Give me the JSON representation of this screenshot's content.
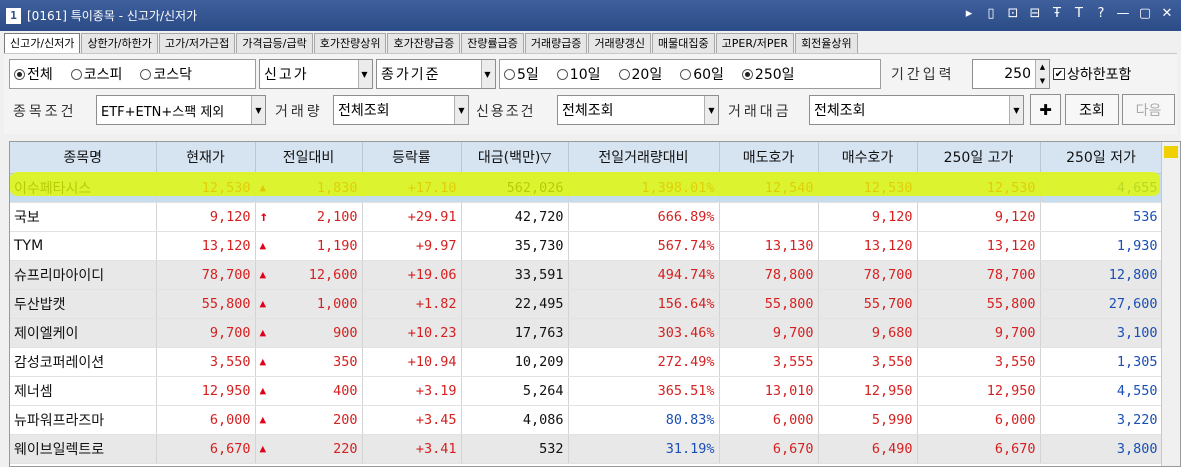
{
  "window": {
    "number": "1",
    "title": "[0161] 특이종목 - 신고가/신저가",
    "icons": [
      "▸",
      "▯",
      "⊡",
      "⊟",
      "Ŧ",
      "T",
      "?",
      "—",
      "▢",
      "✕"
    ]
  },
  "tabs": [
    {
      "label": "신고가/신저가",
      "active": true
    },
    {
      "label": "상한가/하한가"
    },
    {
      "label": "고가/저가근접"
    },
    {
      "label": "가격급등/급락"
    },
    {
      "label": "호가잔량상위"
    },
    {
      "label": "호가잔량급증"
    },
    {
      "label": "잔량률급증"
    },
    {
      "label": "거래량급증"
    },
    {
      "label": "거래량갱신"
    },
    {
      "label": "매물대집중"
    },
    {
      "label": "고PER/저PER"
    },
    {
      "label": "회전율상위"
    }
  ],
  "filters": {
    "market_radios": [
      {
        "label": "전체",
        "checked": true
      },
      {
        "label": "코스피",
        "checked": false
      },
      {
        "label": "코스닥",
        "checked": false
      }
    ],
    "type_select": "신고가",
    "basis_select": "종가기준",
    "period_radios": [
      {
        "label": "5일",
        "checked": false
      },
      {
        "label": "10일",
        "checked": false
      },
      {
        "label": "20일",
        "checked": false
      },
      {
        "label": "60일",
        "checked": false
      },
      {
        "label": "250일",
        "checked": true
      }
    ],
    "period_input_label": "기간입력",
    "period_input_value": "250",
    "limit_checkbox_label": "상하한포함",
    "limit_checkbox_checked": true,
    "stock_cond_label": "종목조건",
    "stock_cond_value": "ETF+ETN+스팩 제외",
    "volume_label": "거래량",
    "volume_value": "전체조회",
    "credit_label": "신용조건",
    "credit_value": "전체조회",
    "amount_label": "거래대금",
    "amount_value": "전체조회",
    "query_button": "조회",
    "next_button": "다음"
  },
  "table": {
    "columns": [
      "종목명",
      "현재가",
      "전일대비",
      "등락률",
      "대금(백만)▽",
      "전일거래량대비",
      "매도호가",
      "매수호가",
      "250일 고가",
      "250일 저가"
    ],
    "rows": [
      {
        "name": "이수페타시스",
        "price": "12,530",
        "sym": "▲",
        "chg": "1,830",
        "rate": "+17.10",
        "amount": "562,026",
        "vol_ratio": "1,398.01%",
        "ask": "12,540",
        "bid": "12,530",
        "high": "12,530",
        "low": "4,655",
        "style": "sel",
        "ratio_color": "up",
        "low_color": "dn"
      },
      {
        "name": "국보",
        "price": "9,120",
        "sym": "↑",
        "chg": "2,100",
        "rate": "+29.91",
        "amount": "42,720",
        "vol_ratio": "666.89%",
        "ask": "",
        "bid": "9,120",
        "high": "9,120",
        "low": "536",
        "style": "white",
        "ratio_color": "up",
        "low_color": "dn"
      },
      {
        "name": "TYM",
        "price": "13,120",
        "sym": "▲",
        "chg": "1,190",
        "rate": "+9.97",
        "amount": "35,730",
        "vol_ratio": "567.74%",
        "ask": "13,130",
        "bid": "13,120",
        "high": "13,120",
        "low": "1,930",
        "style": "white",
        "ratio_color": "up",
        "low_color": "dn"
      },
      {
        "name": "슈프리마아이디",
        "price": "78,700",
        "sym": "▲",
        "chg": "12,600",
        "rate": "+19.06",
        "amount": "33,591",
        "vol_ratio": "494.74%",
        "ask": "78,800",
        "bid": "78,700",
        "high": "78,700",
        "low": "12,800",
        "style": "gray",
        "ratio_color": "up",
        "low_color": "dn"
      },
      {
        "name": "두산밥캣",
        "price": "55,800",
        "sym": "▲",
        "chg": "1,000",
        "rate": "+1.82",
        "amount": "22,495",
        "vol_ratio": "156.64%",
        "ask": "55,800",
        "bid": "55,700",
        "high": "55,800",
        "low": "27,600",
        "style": "gray",
        "ratio_color": "up",
        "low_color": "dn"
      },
      {
        "name": "제이엘케이",
        "price": "9,700",
        "sym": "▲",
        "chg": "900",
        "rate": "+10.23",
        "amount": "17,763",
        "vol_ratio": "303.46%",
        "ask": "9,700",
        "bid": "9,680",
        "high": "9,700",
        "low": "3,100",
        "style": "gray",
        "ratio_color": "up",
        "low_color": "dn"
      },
      {
        "name": "감성코퍼레이션",
        "price": "3,550",
        "sym": "▲",
        "chg": "350",
        "rate": "+10.94",
        "amount": "10,209",
        "vol_ratio": "272.49%",
        "ask": "3,555",
        "bid": "3,550",
        "high": "3,550",
        "low": "1,305",
        "style": "white",
        "ratio_color": "up",
        "low_color": "dn"
      },
      {
        "name": "제너셈",
        "price": "12,950",
        "sym": "▲",
        "chg": "400",
        "rate": "+3.19",
        "amount": "5,264",
        "vol_ratio": "365.51%",
        "ask": "13,010",
        "bid": "12,950",
        "high": "12,950",
        "low": "4,550",
        "style": "white",
        "ratio_color": "up",
        "low_color": "dn"
      },
      {
        "name": "뉴파워프라즈마",
        "price": "6,000",
        "sym": "▲",
        "chg": "200",
        "rate": "+3.45",
        "amount": "4,086",
        "vol_ratio": "80.83%",
        "ask": "6,000",
        "bid": "5,990",
        "high": "6,000",
        "low": "3,220",
        "style": "white",
        "ratio_color": "dn",
        "low_color": "dn"
      },
      {
        "name": "웨이브일렉트로",
        "price": "6,670",
        "sym": "▲",
        "chg": "220",
        "rate": "+3.41",
        "amount": "532",
        "vol_ratio": "31.19%",
        "ask": "6,670",
        "bid": "6,490",
        "high": "6,670",
        "low": "3,800",
        "style": "gray",
        "ratio_color": "dn",
        "low_color": "dn"
      }
    ]
  },
  "colors": {
    "up": "#d62020",
    "down": "#1a4fb5",
    "title_bar": "#2b4c86",
    "highlight": "#e1fa00"
  }
}
